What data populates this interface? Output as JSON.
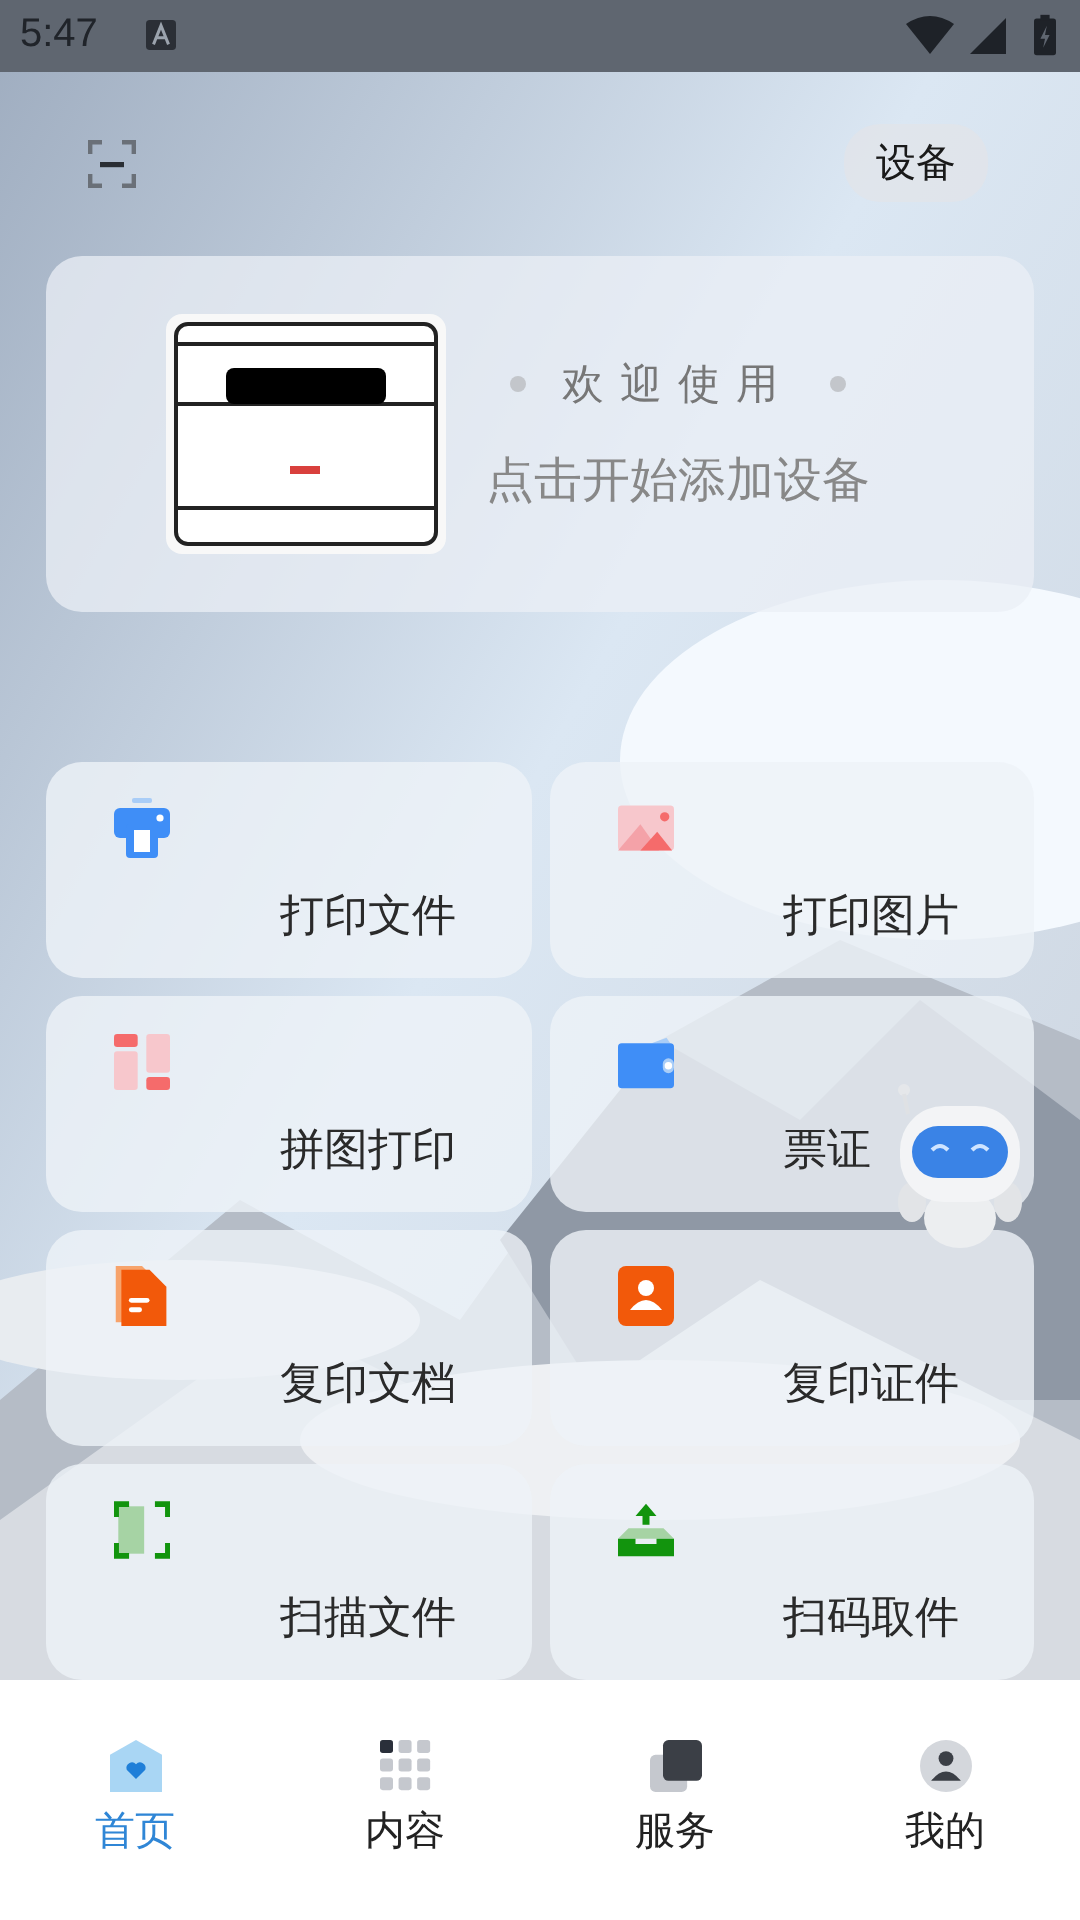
{
  "status_bar": {
    "time": "5:47"
  },
  "header": {
    "device_button": "设备"
  },
  "welcome_card": {
    "greeting": "欢迎使用",
    "prompt": "点击开始添加设备"
  },
  "tiles": [
    {
      "kind": "print-file",
      "label": "打印文件"
    },
    {
      "kind": "print-photo",
      "label": "打印图片"
    },
    {
      "kind": "collage",
      "label": "拼图打印"
    },
    {
      "kind": "ticket",
      "label": "票证"
    },
    {
      "kind": "copy-doc",
      "label": "复印文档"
    },
    {
      "kind": "copy-id",
      "label": "复印证件"
    },
    {
      "kind": "scan",
      "label": "扫描文件"
    },
    {
      "kind": "pickup",
      "label": "扫码取件"
    }
  ],
  "nav_tabs": [
    {
      "kind": "home",
      "label": "首页",
      "selected": true
    },
    {
      "kind": "content",
      "label": "内容",
      "selected": false
    },
    {
      "kind": "service",
      "label": "服务",
      "selected": false
    },
    {
      "kind": "mine",
      "label": "我的",
      "selected": false
    }
  ]
}
